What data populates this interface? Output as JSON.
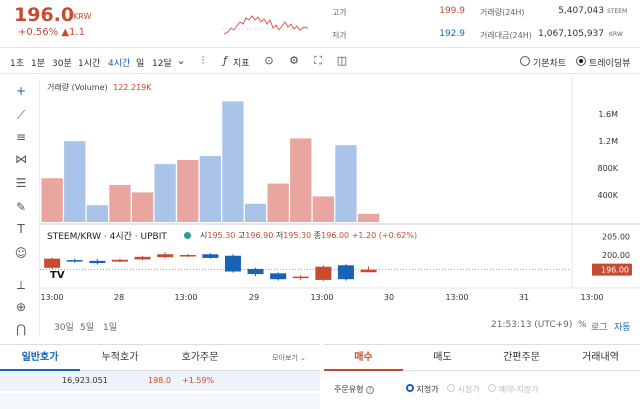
{
  "header": {
    "price": "196.0",
    "currency": "KRW",
    "change_pct": "+0.56%",
    "change_abs": "▲1.1",
    "high_label": "고가",
    "high_value": "199.9",
    "low_label": "저가",
    "low_value": "192.9",
    "volume_label": "거래량(24H)",
    "volume_value": "5,407,043",
    "volume_unit": "STEEM",
    "amount_label": "거래대금(24H)",
    "amount_value": "1,067,105,937",
    "amount_unit": "KRW"
  },
  "toolbar": {
    "intervals": [
      "1초",
      "1분",
      "30분",
      "1시간",
      "4시간",
      "일",
      "12달"
    ],
    "active_interval": "4시간",
    "indicator_label": "지표",
    "basic_chart_label": "기본차트",
    "tradingview_label": "트레이딩뷰"
  },
  "chart": {
    "volume_label": "거래량 (Volume)",
    "volume_value": "122.219K",
    "symbol_label": "STEEM/KRW · 4시간 · UPBIT",
    "ohlc": {
      "open_label": "시",
      "open": "195.30",
      "high_label": "고",
      "high": "196.90",
      "low_label": "저",
      "low": "195.30",
      "close_label": "종",
      "close": "196.00",
      "change": "+1.20 (+0.62%)"
    },
    "vol_axis_labels": [
      "1.6M",
      "1.2M",
      "800K",
      "400K"
    ],
    "price_axis_labels": [
      "205.00",
      "200.00"
    ],
    "last_price_tag": "196.00",
    "time_labels": [
      "13:00",
      "28",
      "13:00",
      "29",
      "13:00",
      "30",
      "13:00",
      "31",
      "13:00"
    ],
    "colors": {
      "up": "#e9a6a0",
      "down": "#a9c4e8",
      "up_candle": "#c84a31",
      "down_candle": "#1763b6"
    }
  },
  "chart_data": {
    "type": "bar",
    "title": "",
    "volume_series": [
      {
        "dir": "up",
        "value": 650000
      },
      {
        "dir": "down",
        "value": 1200000
      },
      {
        "dir": "down",
        "value": 250000
      },
      {
        "dir": "up",
        "value": 550000
      },
      {
        "dir": "up",
        "value": 440000
      },
      {
        "dir": "down",
        "value": 860000
      },
      {
        "dir": "up",
        "value": 920000
      },
      {
        "dir": "down",
        "value": 980000
      },
      {
        "dir": "down",
        "value": 1790000
      },
      {
        "dir": "down",
        "value": 270000
      },
      {
        "dir": "up",
        "value": 570000
      },
      {
        "dir": "up",
        "value": 1240000
      },
      {
        "dir": "up",
        "value": 380000
      },
      {
        "dir": "down",
        "value": 1140000
      },
      {
        "dir": "up",
        "value": 122219
      }
    ],
    "candles": [
      {
        "dir": "up",
        "open": 196.5,
        "close": 199.0,
        "high": 199.3,
        "low": 196.2
      },
      {
        "dir": "down",
        "open": 198.6,
        "close": 198.2,
        "high": 199.0,
        "low": 197.9
      },
      {
        "dir": "down",
        "open": 198.4,
        "close": 197.8,
        "high": 198.9,
        "low": 197.4
      },
      {
        "dir": "up",
        "open": 198.2,
        "close": 198.7,
        "high": 199.0,
        "low": 198.0
      },
      {
        "dir": "up",
        "open": 198.8,
        "close": 199.5,
        "high": 199.8,
        "low": 198.6
      },
      {
        "dir": "up",
        "open": 199.4,
        "close": 200.2,
        "high": 200.8,
        "low": 199.1
      },
      {
        "dir": "up",
        "open": 199.7,
        "close": 200.0,
        "high": 200.3,
        "low": 199.4
      },
      {
        "dir": "down",
        "open": 200.2,
        "close": 199.2,
        "high": 200.5,
        "low": 199.0
      },
      {
        "dir": "down",
        "open": 199.8,
        "close": 195.5,
        "high": 200.2,
        "low": 195.2
      },
      {
        "dir": "down",
        "open": 196.2,
        "close": 194.8,
        "high": 196.5,
        "low": 194.2
      },
      {
        "dir": "down",
        "open": 195.0,
        "close": 193.4,
        "high": 195.3,
        "low": 193.0
      },
      {
        "dir": "up",
        "open": 193.8,
        "close": 194.1,
        "high": 194.5,
        "low": 193.2
      },
      {
        "dir": "up",
        "open": 193.2,
        "close": 196.8,
        "high": 197.2,
        "low": 192.9
      },
      {
        "dir": "down",
        "open": 197.2,
        "close": 193.4,
        "high": 197.5,
        "low": 193.0
      },
      {
        "dir": "up",
        "open": 195.3,
        "close": 196.0,
        "high": 196.9,
        "low": 195.3
      }
    ],
    "ylim_volume": [
      0,
      1900000
    ],
    "ylim_price": [
      191,
      206
    ]
  },
  "bottom": {
    "ranges": [
      "30일",
      "5일",
      "1일"
    ],
    "time": "21:53:13 (UTC+9)",
    "pct": "%",
    "log": "로그",
    "auto": "자동"
  },
  "orderbook": {
    "tabs": [
      "일반호가",
      "누적호가",
      "호가주문"
    ],
    "collapse": "모아보기",
    "row_qty": "16,923.051",
    "row_price": "198.0",
    "row_pct": "+1.59%"
  },
  "order": {
    "tabs": [
      "매수",
      "매도",
      "간편주문",
      "거래내역"
    ],
    "type_label": "주문유형",
    "options": [
      "지정가",
      "시장가",
      "예약-지정가"
    ]
  }
}
